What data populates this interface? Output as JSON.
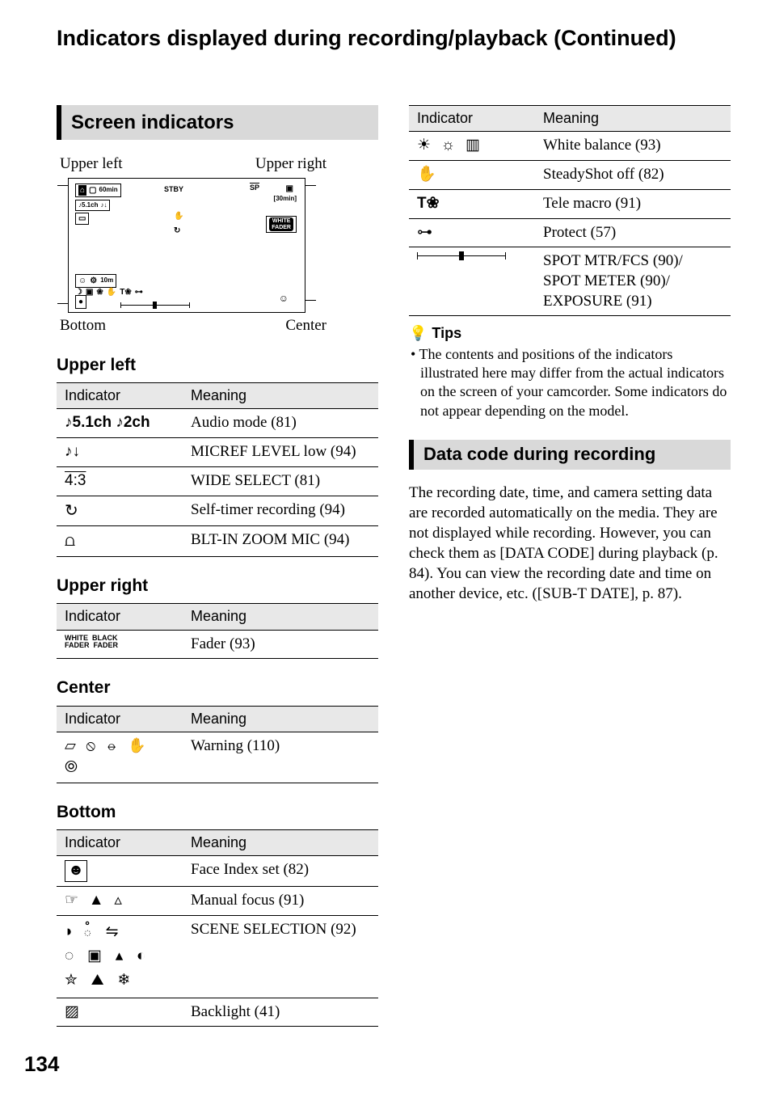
{
  "page_title": "Indicators displayed during recording/playback (Continued)",
  "page_number": "134",
  "left": {
    "section_title": "Screen indicators",
    "diagram_labels": {
      "upper_left": "Upper left",
      "upper_right": "Upper right",
      "bottom": "Bottom",
      "center": "Center"
    },
    "diagram_text": {
      "stby": "STBY",
      "sixty_min": "60min",
      "thirty_min": "[30min]",
      "white_fader": "WHITE\nFADER",
      "audio": "♪5.1ch",
      "ten_m": "10m",
      "sp": "SP"
    },
    "table_headers": {
      "indicator": "Indicator",
      "meaning": "Meaning"
    },
    "upper_left_section": {
      "heading": "Upper left",
      "rows": [
        {
          "ind": "♪5.1ch ♪2ch",
          "mean": "Audio mode (81)"
        },
        {
          "ind": "mic-low-icon",
          "mean": "MICREF LEVEL low (94)"
        },
        {
          "ind": "4:3",
          "mean": "WIDE SELECT (81)"
        },
        {
          "ind": "self-timer-icon",
          "mean": "Self-timer recording (94)"
        },
        {
          "ind": "zoom-mic-icon",
          "mean": "BLT-IN ZOOM MIC (94)"
        }
      ]
    },
    "upper_right_section": {
      "heading": "Upper right",
      "rows": [
        {
          "ind": "WHITE FADER  BLACK FADER",
          "mean": "Fader (93)"
        }
      ]
    },
    "center_section": {
      "heading": "Center",
      "rows": [
        {
          "ind": "warning-icons",
          "mean": "Warning (110)"
        }
      ]
    },
    "bottom_section": {
      "heading": "Bottom",
      "rows": [
        {
          "ind": "face-index-icon",
          "mean": "Face Index set (82)"
        },
        {
          "ind": "manual-focus-icons",
          "mean": "Manual focus (91)"
        },
        {
          "ind": "scene-selection-icons",
          "mean": "SCENE SELECTION (92)"
        },
        {
          "ind": "backlight-icon",
          "mean": "Backlight (41)"
        }
      ]
    }
  },
  "right": {
    "continuation_rows": [
      {
        "ind": "white-balance-icons",
        "mean": "White balance (93)"
      },
      {
        "ind": "steadyshot-off-icon",
        "mean": "SteadyShot off (82)"
      },
      {
        "ind": "tele-macro-icon",
        "mean": "Tele macro (91)"
      },
      {
        "ind": "protect-icon",
        "mean": "Protect (57)"
      },
      {
        "ind": "exposure-slider-icon",
        "mean": "SPOT MTR/FCS (90)/\nSPOT METER (90)/\nEXPOSURE (91)"
      }
    ],
    "tips_heading": "Tips",
    "tips_text": "• The contents and positions of the indicators illustrated here may differ from the actual indicators on the screen of your camcorder. Some indicators do not appear depending on the model.",
    "data_code_heading": "Data code during recording",
    "data_code_body": "The recording date, time, and camera setting data are recorded automatically on the media. They are not displayed while recording. However, you can check them as [DATA CODE] during playback (p. 84). You can view the recording date and time on another device, etc. ([SUB-T DATE], p. 87)."
  }
}
